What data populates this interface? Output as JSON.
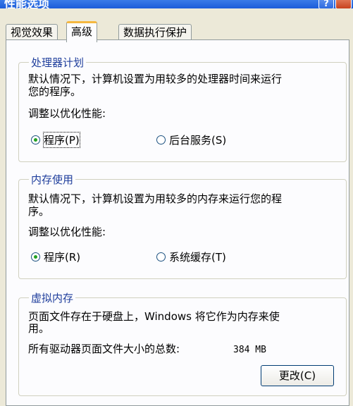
{
  "window": {
    "title": "性能选项"
  },
  "tabs": [
    {
      "label": "视觉效果"
    },
    {
      "label": "高级"
    },
    {
      "label": "数据执行保护"
    }
  ],
  "processor": {
    "title": "处理器计划",
    "desc_line1": "默认情况下，计算机设置为用较多的处理器时间来运行",
    "desc_line2": "您的程序。",
    "adjust_label": "调整以优化性能:",
    "option_programs": "程序(P)",
    "option_services": "后台服务(S)",
    "selected": "程序(P)"
  },
  "memory": {
    "title": "内存使用",
    "desc_line1": "默认情况下，计算机设置为用较多的内存来运行您的程",
    "desc_line2": "序。",
    "adjust_label": "调整以优化性能:",
    "option_programs": "程序(R)",
    "option_cache": "系统缓存(T)",
    "selected": "程序(R)"
  },
  "virtual_memory": {
    "title": "虚拟内存",
    "desc_line1": "页面文件存在于硬盘上，Windows 将它作为内存来使",
    "desc_line2": "用。",
    "total_label": "所有驱动器页面文件大小的总数:",
    "total_value": "384 MB",
    "change_button": "更改(C)"
  }
}
